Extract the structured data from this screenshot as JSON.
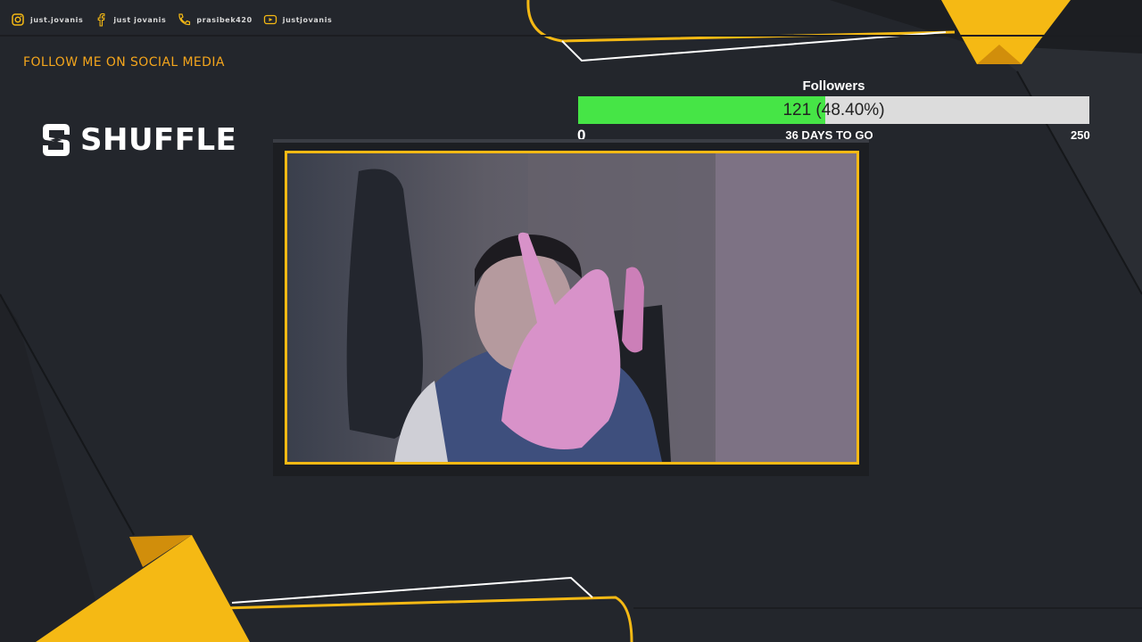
{
  "social": [
    {
      "icon": "instagram-icon",
      "handle": "just.jovanis"
    },
    {
      "icon": "facebook-icon",
      "handle": "just jovanis"
    },
    {
      "icon": "phone-icon",
      "handle": "prasibek420"
    },
    {
      "icon": "youtube-icon",
      "handle": "justjovanis"
    }
  ],
  "follow_heading": "FOLLOW ME ON SOCIAL MEDIA",
  "sponsor": {
    "name": "SHUFFLE"
  },
  "goal": {
    "title": "Followers",
    "current": 121,
    "target": 250,
    "min": 0,
    "progress_fraction": 0.484,
    "label": "121 (48.40%)",
    "min_label": "0",
    "max_label": "250",
    "days_left": "36 DAYS TO GO"
  },
  "webcam": {
    "description_icon": "webcam-feed"
  },
  "colors": {
    "background": "#23262c",
    "accent_yellow": "#f5b914",
    "accent_orange": "#f4a51c",
    "goal_fill": "#46e546",
    "goal_track": "#dcdcdc"
  }
}
